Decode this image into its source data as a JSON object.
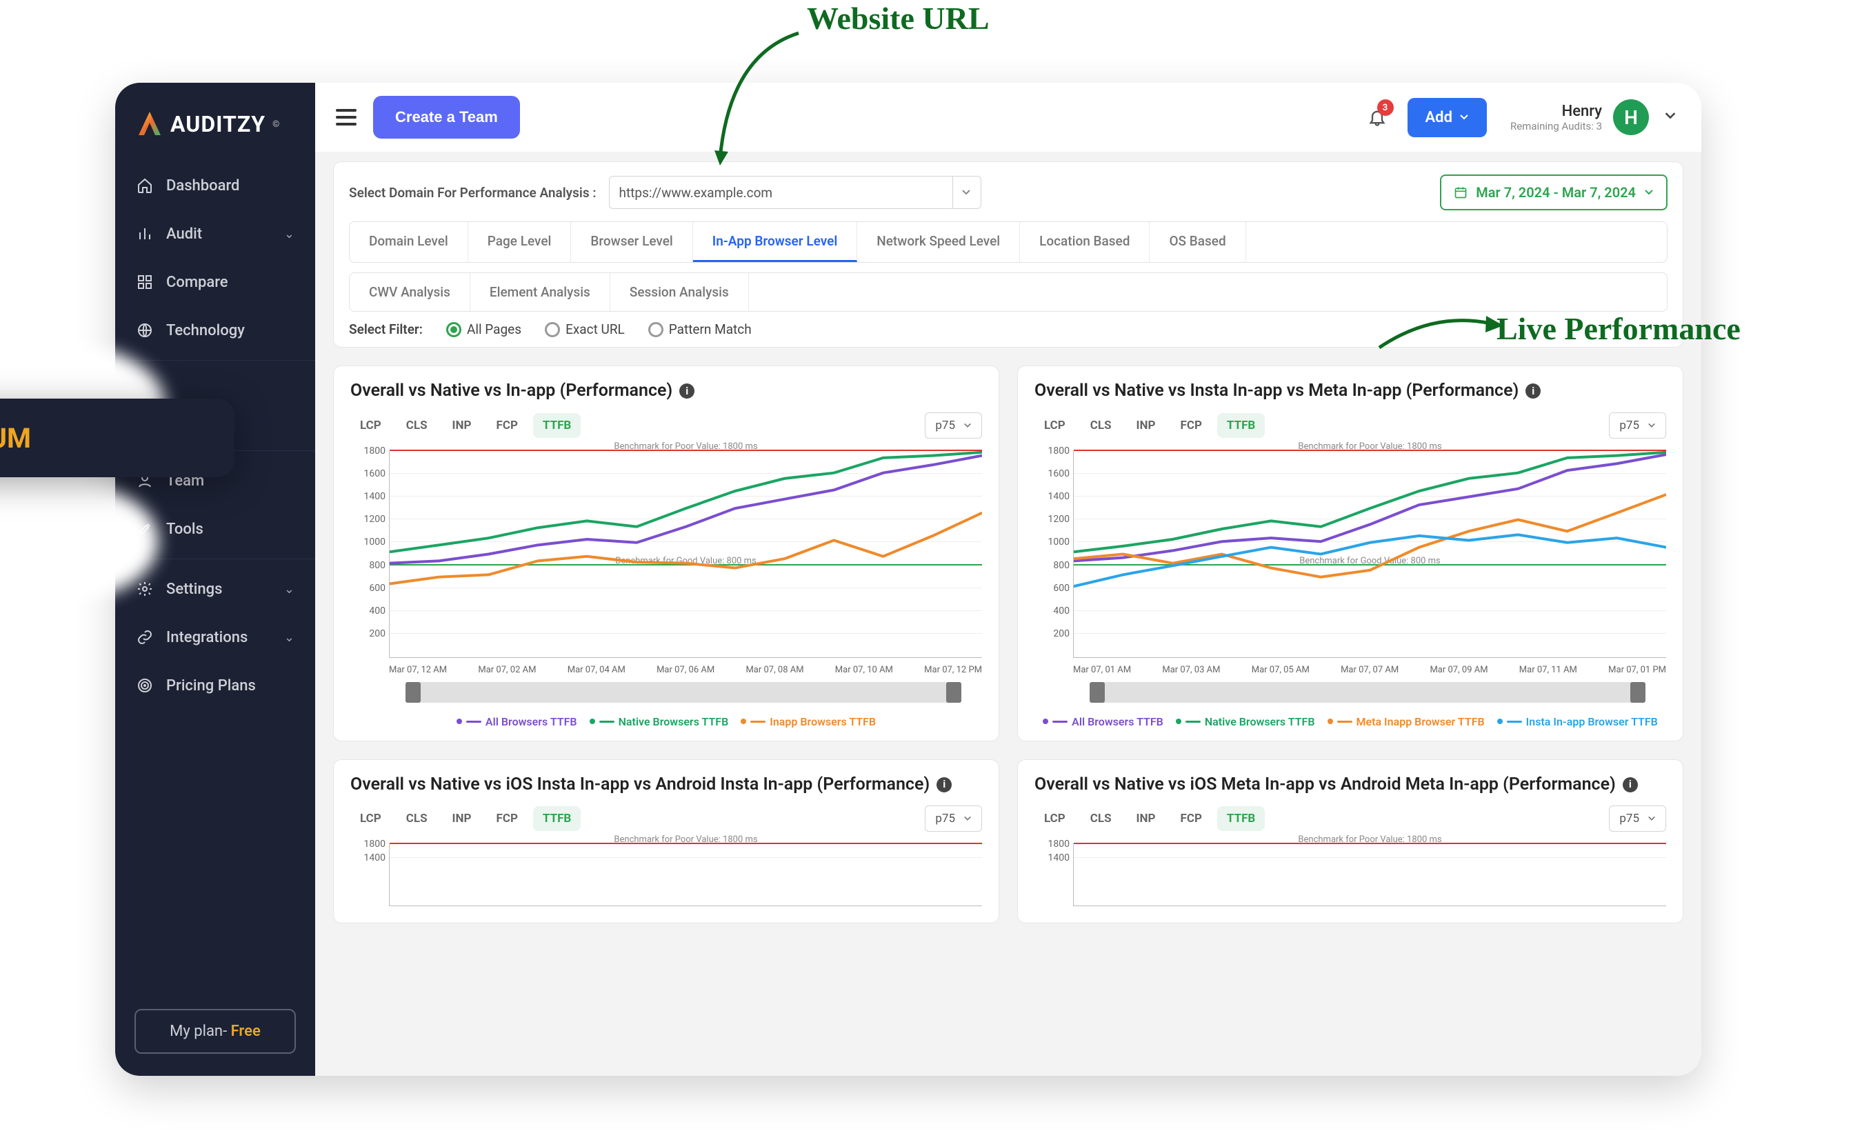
{
  "annotations": {
    "website_url": "Website URL",
    "live_perf": "Live Performance"
  },
  "brand": {
    "name": "AUDITZY",
    "mark": "©"
  },
  "sidebar": {
    "items": [
      {
        "icon": "home",
        "label": "Dashboard",
        "chev": false
      },
      {
        "icon": "bars",
        "label": "Audit",
        "chev": true
      },
      {
        "icon": "grid",
        "label": "Compare",
        "chev": false
      },
      {
        "icon": "globe",
        "label": "Technology",
        "chev": false
      }
    ],
    "rum_label": "RUM",
    "items2": [
      {
        "icon": "user",
        "label": "Team"
      },
      {
        "icon": "tools",
        "label": "Tools"
      }
    ],
    "items3": [
      {
        "icon": "gear",
        "label": "Settings",
        "chev": true
      },
      {
        "icon": "link",
        "label": "Integrations",
        "chev": true
      },
      {
        "icon": "target",
        "label": "Pricing Plans",
        "chev": false
      }
    ],
    "plan_prefix": "My plan- ",
    "plan_name": "Free"
  },
  "topbar": {
    "create_team": "Create a Team",
    "add_label": "Add",
    "bell_count": "3",
    "user_name": "Henry",
    "user_sub": "Remaining Audits: 3",
    "user_initial": "H"
  },
  "filters": {
    "label": "Select Domain For Performance Analysis :",
    "domain_value": "https://www.example.com",
    "date_range": "Mar 7, 2024 - Mar 7, 2024",
    "tabs_row1": [
      {
        "label": "Domain Level",
        "active": false
      },
      {
        "label": "Page Level",
        "active": false
      },
      {
        "label": "Browser Level",
        "active": false
      },
      {
        "label": "In-App Browser Level",
        "active": true
      },
      {
        "label": "Network Speed Level",
        "active": false
      },
      {
        "label": "Location Based",
        "active": false
      },
      {
        "label": "OS Based",
        "active": false
      }
    ],
    "tabs_row2": [
      {
        "label": "CWV Analysis"
      },
      {
        "label": "Element Analysis"
      },
      {
        "label": "Session Analysis"
      }
    ],
    "select_filter_label": "Select Filter:",
    "radios": [
      {
        "label": "All Pages",
        "on": true
      },
      {
        "label": "Exact URL",
        "on": false
      },
      {
        "label": "Pattern Match",
        "on": false
      }
    ]
  },
  "metrics": [
    "LCP",
    "CLS",
    "INP",
    "FCP",
    "TTFB"
  ],
  "active_metric": "TTFB",
  "percentile": "p75",
  "cards": [
    {
      "title": "Overall vs Native vs In-app (Performance)",
      "legend": [
        {
          "name": "All Browsers TTFB",
          "color": "#7a4ecf"
        },
        {
          "name": "Native Browsers TTFB",
          "color": "#1aa563"
        },
        {
          "name": "Inapp Browsers TTFB",
          "color": "#ef8a2b"
        }
      ],
      "xticks": [
        "Mar 07, 12 AM",
        "Mar 07, 02 AM",
        "Mar 07, 04 AM",
        "Mar 07, 06 AM",
        "Mar 07, 08 AM",
        "Mar 07, 10 AM",
        "Mar 07, 12 PM"
      ],
      "chart_data": {
        "type": "line",
        "ylim": [
          0,
          1800
        ],
        "yticks": [
          200,
          400,
          600,
          800,
          1000,
          1200,
          1400,
          1600,
          1800
        ],
        "benchmark_poor": {
          "value": 1800,
          "label": "Benchmark for Poor Value: 1800 ms"
        },
        "benchmark_good": {
          "value": 800,
          "label": "Benchmark for Good Value: 800 ms"
        },
        "x": [
          0,
          1,
          2,
          3,
          4,
          5,
          6,
          7,
          8,
          9,
          10,
          11,
          12
        ],
        "series": [
          {
            "name": "All Browsers TTFB",
            "color": "#7a4ecf",
            "values": [
              820,
              840,
              900,
              980,
              1030,
              1000,
              1140,
              1300,
              1380,
              1460,
              1610,
              1680,
              1760
            ]
          },
          {
            "name": "Native Browsers TTFB",
            "color": "#1aa563",
            "values": [
              920,
              980,
              1040,
              1130,
              1190,
              1140,
              1300,
              1450,
              1560,
              1610,
              1740,
              1760,
              1790
            ]
          },
          {
            "name": "Inapp Browsers TTFB",
            "color": "#ef8a2b",
            "values": [
              640,
              700,
              720,
              840,
              880,
              830,
              820,
              780,
              860,
              1020,
              880,
              1060,
              1260
            ]
          }
        ]
      }
    },
    {
      "title": "Overall vs Native vs Insta In-app vs Meta In-app (Performance)",
      "legend": [
        {
          "name": "All Browsers TTFB",
          "color": "#7a4ecf"
        },
        {
          "name": "Native Browsers TTFB",
          "color": "#1aa563"
        },
        {
          "name": "Meta Inapp Browser TTFB",
          "color": "#ef8a2b"
        },
        {
          "name": "Insta In-app Browser TTFB",
          "color": "#2aa4e8"
        }
      ],
      "xticks": [
        "Mar 07, 01 AM",
        "Mar 07, 03 AM",
        "Mar 07, 05 AM",
        "Mar 07, 07 AM",
        "Mar 07, 09 AM",
        "Mar 07, 11 AM",
        "Mar 07, 01 PM"
      ],
      "chart_data": {
        "type": "line",
        "ylim": [
          0,
          1800
        ],
        "yticks": [
          200,
          400,
          600,
          800,
          1000,
          1200,
          1400,
          1600,
          1800
        ],
        "benchmark_poor": {
          "value": 1800,
          "label": "Benchmark for Poor Value: 1800 ms"
        },
        "benchmark_good": {
          "value": 800,
          "label": "Benchmark for Good Value: 800 ms"
        },
        "x": [
          0,
          1,
          2,
          3,
          4,
          5,
          6,
          7,
          8,
          9,
          10,
          11,
          12
        ],
        "series": [
          {
            "name": "All Browsers TTFB",
            "color": "#7a4ecf",
            "values": [
              840,
              870,
              930,
              1010,
              1040,
              1010,
              1160,
              1330,
              1400,
              1470,
              1630,
              1690,
              1770
            ]
          },
          {
            "name": "Native Browsers TTFB",
            "color": "#1aa563",
            "values": [
              920,
              970,
              1030,
              1120,
              1190,
              1140,
              1300,
              1450,
              1560,
              1610,
              1740,
              1760,
              1790
            ]
          },
          {
            "name": "Meta Inapp Browser TTFB",
            "color": "#ef8a2b",
            "values": [
              860,
              900,
              820,
              900,
              780,
              700,
              760,
              960,
              1100,
              1200,
              1100,
              1260,
              1420
            ]
          },
          {
            "name": "Insta In-app Browser TTFB",
            "color": "#2aa4e8",
            "values": [
              620,
              720,
              800,
              880,
              960,
              900,
              1000,
              1060,
              1020,
              1070,
              1000,
              1040,
              960
            ]
          }
        ]
      }
    },
    {
      "title": "Overall vs Native vs iOS Insta In-app vs Android Insta In-app (Performance)",
      "legend": [],
      "partial": true,
      "chart_data": {
        "type": "line",
        "ylim": [
          0,
          1800
        ],
        "yticks": [
          1400,
          1800
        ],
        "benchmark_poor": {
          "value": 1800,
          "label": "Benchmark for Poor Value: 1800 ms"
        }
      }
    },
    {
      "title": "Overall vs Native vs iOS Meta In-app vs Android Meta In-app (Performance)",
      "legend": [],
      "partial": true,
      "chart_data": {
        "type": "line",
        "ylim": [
          0,
          1800
        ],
        "yticks": [
          1400,
          1800
        ],
        "benchmark_poor": {
          "value": 1800,
          "label": "Benchmark for Poor Value: 1800 ms"
        }
      }
    }
  ]
}
